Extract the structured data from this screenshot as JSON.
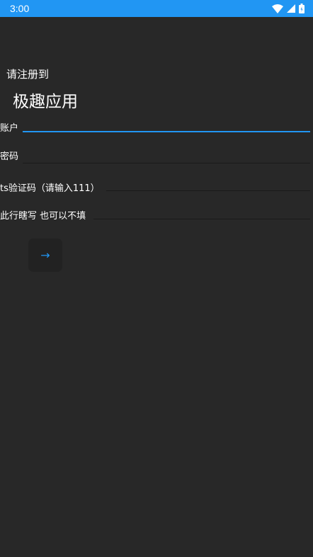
{
  "status_bar": {
    "time": "3:00",
    "color": "#2196F3",
    "icons": [
      "wifi-icon",
      "signal-icon",
      "battery-icon"
    ]
  },
  "header": {
    "subtitle": "请注册到",
    "title": "极趣应用"
  },
  "form": {
    "account_label": "账户",
    "password_label": "密码",
    "captcha_label": "ts验证码（请输入111）",
    "extra_label": "此行瞎写 也可以不填"
  },
  "submit": {
    "icon": "arrow-right-icon",
    "glyph": "→"
  },
  "colors": {
    "accent": "#2196F3",
    "background": "#282828"
  }
}
